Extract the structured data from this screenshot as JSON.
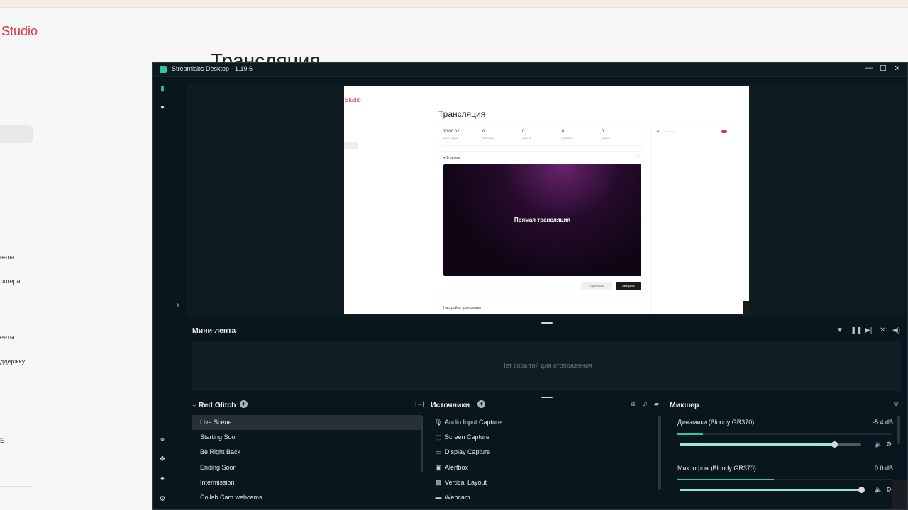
{
  "background_page": {
    "url_fragment": "…",
    "logo": "Studio",
    "title": "Трансляция",
    "nav_fragments": [
      "нала",
      "логера",
      "ееты",
      "ддержку",
      "E"
    ]
  },
  "window": {
    "title": "Streamlabs Desktop - 1.19.6",
    "controls": {
      "minimize": "—",
      "maximize": "☐",
      "close": "✕"
    }
  },
  "preview": {
    "logo": "Studio",
    "title": "Трансляция",
    "stats": [
      {
        "value": "00:00:02",
        "label": "Время в эфире"
      },
      {
        "value": "0",
        "label": "Трансляция"
      },
      {
        "value": "0",
        "label": "Новых сп."
      },
      {
        "value": "0",
        "label": "Активность"
      },
      {
        "value": "0",
        "label": "Донатов"
      }
    ],
    "side_placeholder": "Событие",
    "live_header": "В эфире",
    "video_text": "Прямая трансляция",
    "button_secondary": "Поделиться",
    "button_primary": "Завершить",
    "settings_header": "Настройки трансляции"
  },
  "feed": {
    "title": "Мини-лента",
    "empty": "Нет событий для отображения"
  },
  "scenes": {
    "title": "Red Glitch",
    "items": [
      "Live Scene",
      "Starting Soon",
      "Be Right Back",
      "Ending Soon",
      "Intermission",
      "Collab Cam webcams"
    ],
    "selected_index": 0
  },
  "sources": {
    "title": "Источники",
    "items": [
      {
        "icon": "microphone-icon",
        "label": "Audio Input Capture"
      },
      {
        "icon": "screen-capture-icon",
        "label": "Screen Capture"
      },
      {
        "icon": "monitor-icon",
        "label": "Display Capture"
      },
      {
        "icon": "alertbox-icon",
        "label": "Alertbox"
      },
      {
        "icon": "image-icon",
        "label": "Vertical Layout"
      },
      {
        "icon": "folder-icon",
        "label": "Webcam"
      }
    ]
  },
  "mixer": {
    "title": "Микшер",
    "channels": [
      {
        "name": "Динамики (Bloody GR370)",
        "db": "-5.4 dB",
        "volume": 0.85,
        "level": 0.12
      },
      {
        "name": "Микрофон (Bloody GR370)",
        "db": "0.0 dB",
        "volume": 1.0,
        "level": 0.45
      }
    ]
  },
  "colors": {
    "accent": "#31c3a2",
    "brand_red": "#e0323c",
    "window_bg": "#09161d"
  }
}
